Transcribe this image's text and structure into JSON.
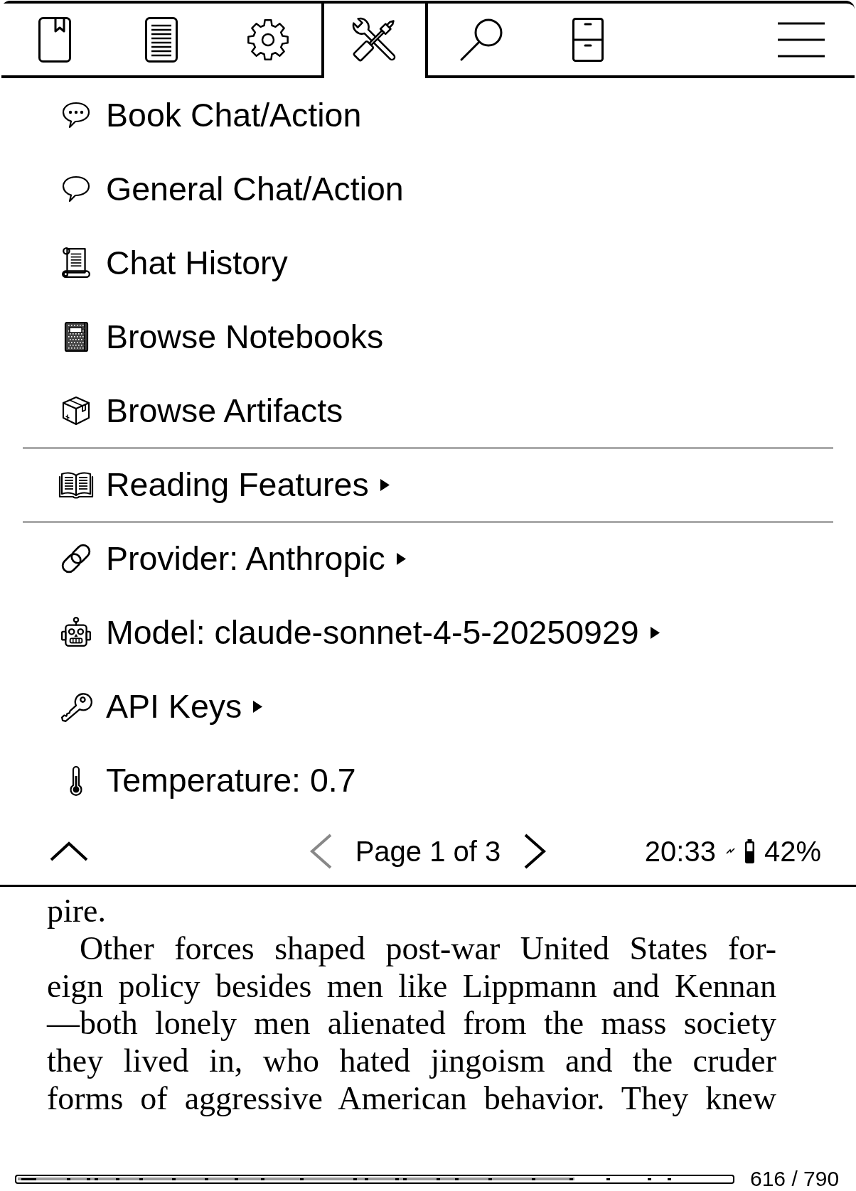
{
  "tabs": [
    {
      "kind": "book",
      "selected": false
    },
    {
      "kind": "contents",
      "selected": false
    },
    {
      "kind": "settings",
      "selected": false
    },
    {
      "kind": "tools",
      "selected": true
    },
    {
      "kind": "search",
      "selected": false
    },
    {
      "kind": "cabinet",
      "selected": false
    }
  ],
  "menu": {
    "sections": [
      {
        "items": [
          {
            "kind": "book_chat",
            "label": "Book Chat/Action",
            "submenu": false
          },
          {
            "kind": "general_chat",
            "label": "General Chat/Action",
            "submenu": false
          },
          {
            "kind": "history",
            "label": "Chat History",
            "submenu": false
          },
          {
            "kind": "notebooks",
            "label": "Browse Notebooks",
            "submenu": false
          },
          {
            "kind": "artifacts",
            "label": "Browse Artifacts",
            "submenu": false
          }
        ]
      },
      {
        "items": [
          {
            "kind": "reading",
            "label": "Reading Features",
            "submenu": true
          }
        ]
      },
      {
        "items": [
          {
            "kind": "provider",
            "label": "Provider: Anthropic",
            "submenu": true
          },
          {
            "kind": "model",
            "label": "Model: claude-sonnet-4-5-20250929",
            "submenu": true
          },
          {
            "kind": "keys",
            "label": "API Keys",
            "submenu": true
          },
          {
            "kind": "temperature",
            "label": "Temperature: 0.7",
            "submenu": false
          }
        ]
      }
    ]
  },
  "footer": {
    "prev_page": {
      "disabled": true
    },
    "page_label": "Page 1 of 3",
    "next_page": {
      "disabled": false
    },
    "time": "20:33",
    "charging": true,
    "battery": "42%"
  },
  "book_page": {
    "paragraphs": [
      {
        "indent": false,
        "lines": [
          "pire."
        ]
      },
      {
        "indent": true,
        "lines": [
          "Other forces shaped post-war United States for-",
          "eign policy besides men like Lippmann and Kennan",
          "—both lonely men alienated from the mass society",
          "they lived in, who hated jingoism and the cruder",
          "forms of aggressive American behavior. They knew"
        ]
      }
    ]
  },
  "progress": {
    "level": 0.78,
    "pages": "616 / 790"
  }
}
